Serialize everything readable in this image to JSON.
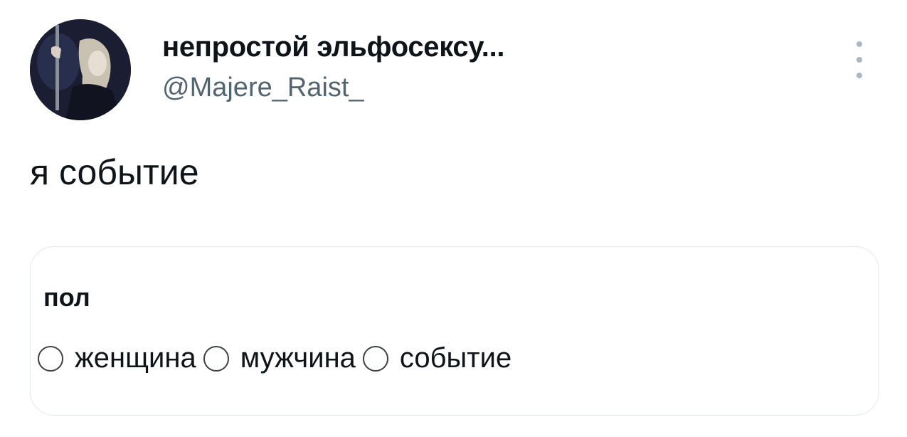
{
  "tweet": {
    "author": {
      "display_name": "непростой эльфосексу...",
      "handle": "@Majere_Raist_",
      "avatar_icon": "profile-photo"
    },
    "menu_icon": "more-vertical-icon",
    "text": "я событие"
  },
  "form_card": {
    "title": "пол",
    "options": [
      {
        "label": "женщина",
        "selected": false
      },
      {
        "label": "мужчина",
        "selected": false
      },
      {
        "label": "событие",
        "selected": false
      }
    ]
  }
}
